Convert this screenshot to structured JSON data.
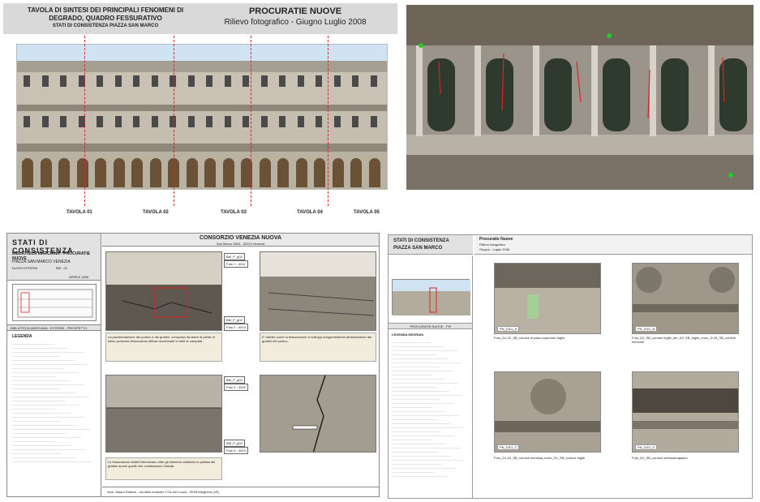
{
  "panel1": {
    "title_line1": "TAVOLA DI SINTESI DEI PRINCIPALI FENOMENI DI DEGRADO, QUADRO FESSURATIVO",
    "title_line2": "STATI DI CONSISTENZA PIAZZA SAN MARCO",
    "building": "PROCURATIE NUOVE",
    "survey": "Rilievo  fotografico - Giugno Luglio 2008",
    "tavole": [
      "TAVOLA 01",
      "TAVOLA 02",
      "TAVOLA 03",
      "TAVOLA 04",
      "TAVOLA 05"
    ]
  },
  "panel3": {
    "heading": "STATI  DI  CONSISTENZA",
    "project": "BIBLIOTECA MARCIANA - PROCURATIE NUOVE",
    "location": "PIAZZA  SAN  MARCO  VENEZIA",
    "sub": "NUOVI ESTERNI",
    "ref": "BM - 01",
    "date": "APRILE 2006",
    "section": "BIBLIOTECA MARCIANA  -  ESTERNI - PROSPETTO",
    "consortium": "CONSORZIO VENEZIA NUOVA",
    "consortium_sub": "San Marco 2803 - 30124 Venezia",
    "legend_title": "LEGENDA",
    "photo_tags": [
      "BM_P_g02",
      "Foto 1 - 4011",
      "BM_P_g02",
      "Foto 2 - 4013",
      "BM_P_g02",
      "Foto 3 - 4020",
      "BM_P_g02",
      "Foto 4 - 4023"
    ],
    "caption1": "La pavimentazione del portico e dei gradini, composta da lastre di pietra di Istria, presenta fessurazioni diffuse accentuate in tutte le campate.",
    "caption2": "E' visibile come la fessurazione si sviluppi ortogonalmente all'andamento dei gradini del portico.",
    "caption3": "Le fessurazioni visibili interessano oltre gli elementi costitutivi la pedata dei gradini anche quelle che costituiscono l'alzata.",
    "footer": "Arch. Mauro Sartore - via delle industrie 17/a ed/ Lucca - VE55 Marghera (VE)"
  },
  "panel4": {
    "heading_line1": "STATI DI CONSISTENZA",
    "heading_line2": "PIAZZA SAN MARCO",
    "subtitle_a": "Procuratie Nuove",
    "subtitle_b": "Rilievo fotografico",
    "subtitle_c": "Giugno - Luglio  2008",
    "legend_head": "PROCURATIE NUOVE  -  PN",
    "legend_title": "LEGENDA DEGRADI",
    "thumb_labels": [
      "PN_D3/1_A",
      "PN_D3/1_B",
      "PN_D3/1_C",
      "PN_D3/1_D"
    ],
    "thumb_captions": [
      "Foto_D1-02_SB_cornice di palco superiore foglio",
      "Foto_D2_SB_cornice foglie_fan_D2_SB_foglie_muro_D-03_SB_cornice mensola",
      "Foto_D1-02_SB_cornice mensola_muro_D1_SB_cornice foglie",
      "Foto_D2_SB_cornice sottomarcapiano"
    ]
  }
}
